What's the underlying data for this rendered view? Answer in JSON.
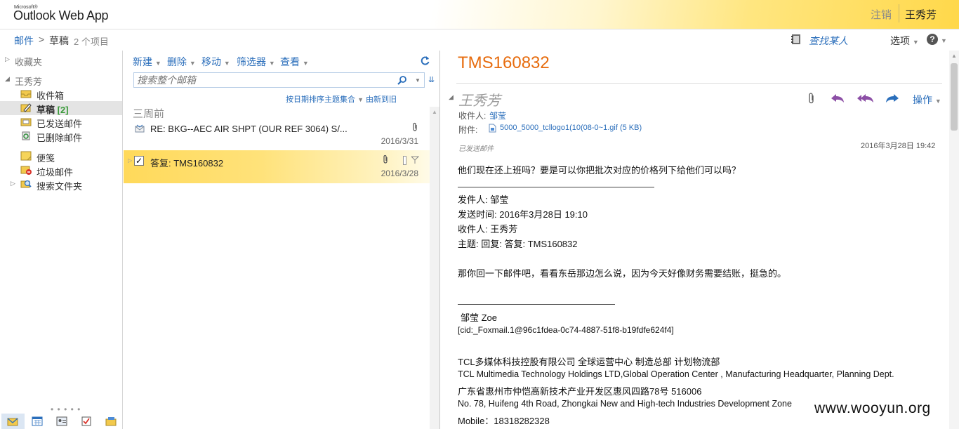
{
  "header": {
    "brand_ms": "Microsoft®",
    "brand_name": "Outlook Web App",
    "signout": "注销",
    "user": "王秀芳"
  },
  "breadcrumb": {
    "mail": "邮件",
    "sep": ">",
    "folder": "草稿",
    "count": "2 个项目",
    "find_people": "查找某人",
    "options": "选项",
    "help": "?"
  },
  "nav": {
    "favorites": "收藏夹",
    "mailbox": "王秀芳",
    "folders": [
      {
        "label": "收件箱",
        "icon": "inbox-icon"
      },
      {
        "label": "草稿",
        "count": "[2]",
        "icon": "drafts-icon",
        "selected": true
      },
      {
        "label": "已发送邮件",
        "icon": "sent-icon"
      },
      {
        "label": "已删除邮件",
        "icon": "deleted-icon"
      },
      {
        "label": "便笺",
        "icon": "notes-icon"
      },
      {
        "label": "垃圾邮件",
        "icon": "junk-icon"
      },
      {
        "label": "搜索文件夹",
        "icon": "search-folder-icon"
      }
    ],
    "dots": "• • • • •"
  },
  "toolbar": {
    "new": "新建",
    "delete": "删除",
    "move": "移动",
    "filter": "筛选器",
    "view": "查看",
    "search_placeholder": "搜索整个邮箱",
    "sort": "按日期排序主题集合",
    "order": "由新到旧"
  },
  "list": {
    "group": "三周前",
    "messages": [
      {
        "subject": "RE: BKG--AEC AIR SHPT (OUR REF 3064) S/...",
        "date": "2016/3/31"
      },
      {
        "subject": "答复: TMS160832",
        "date": "2016/3/28",
        "selected": true
      }
    ]
  },
  "reading": {
    "title": "TMS160832",
    "sender": "王秀芳",
    "to_label": "收件人:",
    "to": "邹莹",
    "att_label": "附件:",
    "attachment": "5000_5000_tcllogo1(10(08-0~1.gif (5 KB)",
    "sent_label": "已发送邮件",
    "sent_time": "2016年3月28日 19:42",
    "actions": "操作",
    "body": {
      "line1": "他们现在还上班吗？要是可以你把批次对应的价格列下给他们可以吗？",
      "from": "发件人: 邹莹",
      "sent": "发送时间: 2016年3月28日 19:10",
      "to": "收件人: 王秀芳",
      "subject": "主题: 回复: 答复: TMS160832",
      "line2": "那你回一下邮件吧，看看东岳那边怎么说，因为今天好像财务需要结账，挺急的。",
      "sig_name": "邹莹  Zoe",
      "sig_cid": "[cid:_Foxmail.1@96c1fdea-0c74-4887-51f8-b19fdfe624f4]",
      "sig_company_cn": "TCL多媒体科技控股有限公司 全球运营中心  制造总部   计划物流部",
      "sig_company_en": "TCL Multimedia Technology Holdings LTD,Global  Operation  Center , Manufacturing Headquarter, Planning  Dept.",
      "sig_addr_cn": "广东省惠州市仲恺高新技术产业开发区惠风四路78号  516006",
      "sig_addr_en": "No. 78, Huifeng 4th Road, Zhongkai New and High-tech Industries Development Zone",
      "sig_mobile": "Mobile：18318282328"
    }
  },
  "watermark": "www.wooyun.org",
  "colors": {
    "accent": "#2a6ebb",
    "title_orange": "#e76c0e",
    "selected_row": "#ffd95a"
  }
}
